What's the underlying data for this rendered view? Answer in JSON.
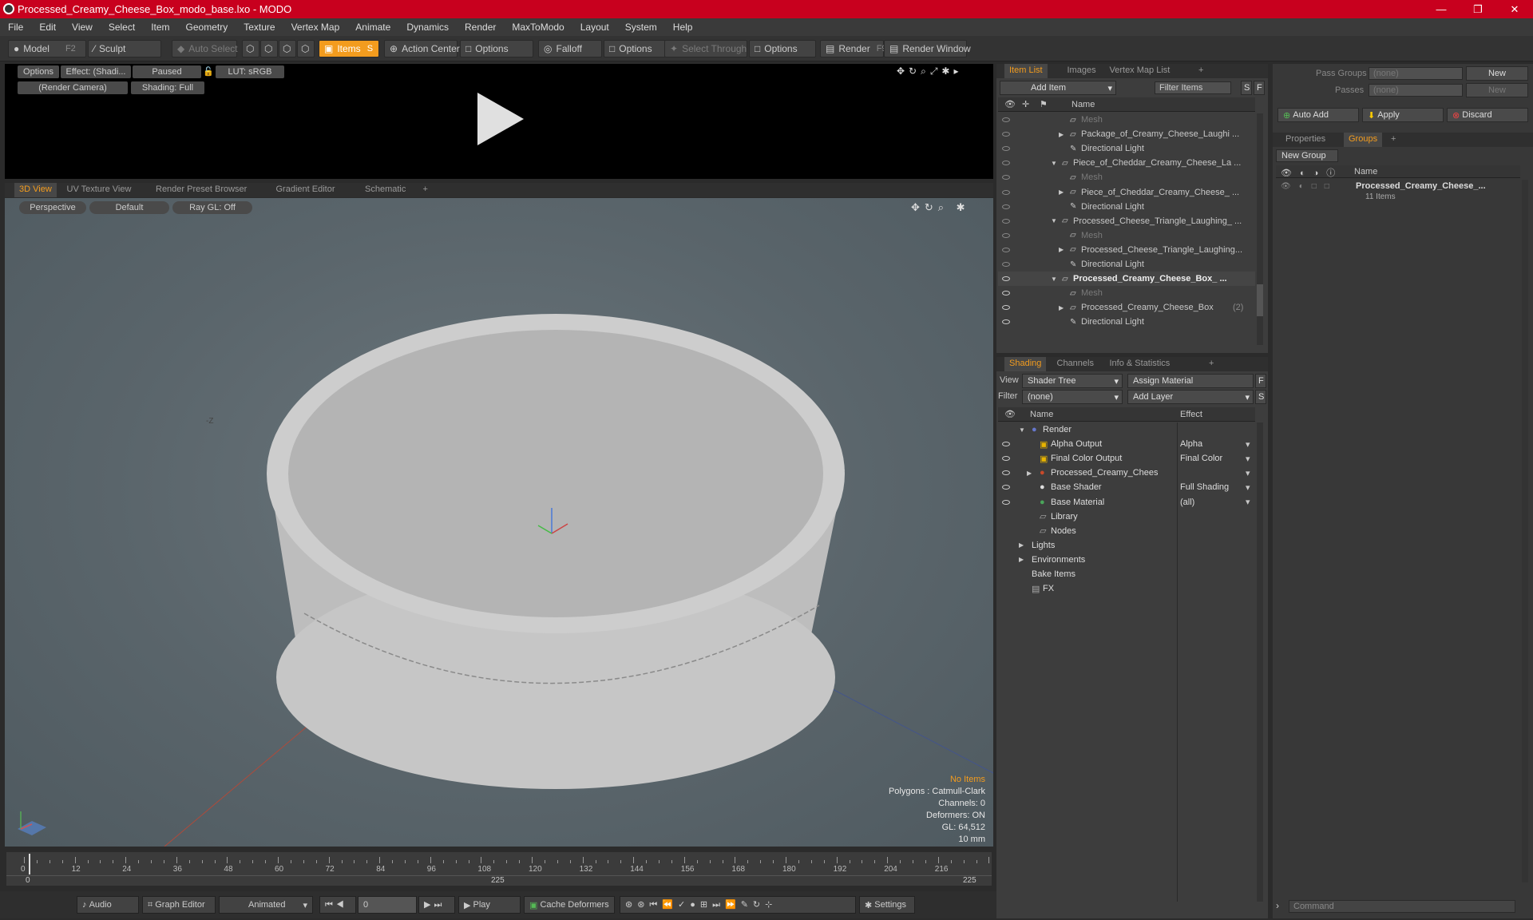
{
  "window": {
    "title": "Processed_Creamy_Cheese_Box_modo_base.lxo - MODO",
    "controls": [
      "—",
      "❐",
      "✕"
    ]
  },
  "menu": [
    "File",
    "Edit",
    "View",
    "Select",
    "Item",
    "Geometry",
    "Texture",
    "Vertex Map",
    "Animate",
    "Dynamics",
    "Render",
    "MaxToModo",
    "Layout",
    "System",
    "Help"
  ],
  "toolbar": {
    "model": "Model",
    "model_key": "F2",
    "sculpt": "Sculpt",
    "auto_select": "Auto Select",
    "items": "Items",
    "items_key": "S",
    "action_center": "Action Center",
    "options1": "Options",
    "falloff": "Falloff",
    "options2": "Options",
    "select_through": "Select Through",
    "options3": "Options",
    "render": "Render",
    "render_key": "F9",
    "render_window": "Render Window"
  },
  "render_preview": {
    "options": "Options",
    "effect": "Effect: (Shadi...",
    "paused": "Paused",
    "lut": "LUT: sRGB",
    "camera": "(Render Camera)",
    "shading": "Shading: Full"
  },
  "viewport_tabs": [
    "3D View",
    "UV Texture View",
    "Render Preset Browser",
    "Gradient Editor",
    "Schematic",
    "+"
  ],
  "viewport": {
    "perspective": "Perspective",
    "default": "Default",
    "raygl": "Ray GL: Off",
    "axis_label": "-Z",
    "stats": {
      "no_items": "No Items",
      "polygons": "Polygons : Catmull-Clark",
      "channels": "Channels: 0",
      "deformers": "Deformers: ON",
      "gl": "GL: 64,512",
      "size": "10 mm"
    }
  },
  "timeline": {
    "ticks": [
      "0",
      "12",
      "24",
      "36",
      "48",
      "60",
      "72",
      "84",
      "96",
      "108",
      "120",
      "132",
      "144",
      "156",
      "168",
      "180",
      "192",
      "204",
      "216"
    ],
    "start": "0",
    "mid": "225",
    "end": "225",
    "current": "0"
  },
  "bottom": {
    "audio": "Audio",
    "graph_editor": "Graph Editor",
    "animated": "Animated",
    "frame": "0",
    "play": "Play",
    "cache": "Cache Deformers",
    "settings": "Settings"
  },
  "item_list": {
    "tabs": [
      "Item List",
      "Images",
      "Vertex Map List",
      "+"
    ],
    "add_item": "Add Item",
    "filter": "Filter Items",
    "s": "S",
    "f": "F",
    "col_name": "Name",
    "rows": [
      {
        "label": "Mesh",
        "indent": 3,
        "dim": true,
        "arrow": ""
      },
      {
        "label": "Package_of_Creamy_Cheese_Laughi ...",
        "indent": 3,
        "dim": false,
        "arrow": "▶"
      },
      {
        "label": "Directional Light",
        "indent": 3,
        "dim": false,
        "arrow": ""
      },
      {
        "label": "Piece_of_Cheddar_Creamy_Cheese_La ...",
        "indent": 2,
        "dim": false,
        "arrow": "▼"
      },
      {
        "label": "Mesh",
        "indent": 3,
        "dim": true,
        "arrow": ""
      },
      {
        "label": "Piece_of_Cheddar_Creamy_Cheese_ ...",
        "indent": 3,
        "dim": false,
        "arrow": "▶"
      },
      {
        "label": "Directional Light",
        "indent": 3,
        "dim": false,
        "arrow": ""
      },
      {
        "label": "Processed_Cheese_Triangle_Laughing_ ...",
        "indent": 2,
        "dim": false,
        "arrow": "▼"
      },
      {
        "label": "Mesh",
        "indent": 3,
        "dim": true,
        "arrow": ""
      },
      {
        "label": "Processed_Cheese_Triangle_Laughing...",
        "indent": 3,
        "dim": false,
        "arrow": "▶"
      },
      {
        "label": "Directional Light",
        "indent": 3,
        "dim": false,
        "arrow": ""
      },
      {
        "label": "Processed_Creamy_Cheese_Box_ ...",
        "indent": 2,
        "dim": false,
        "arrow": "▼",
        "bold": true
      },
      {
        "label": "Mesh",
        "indent": 3,
        "dim": true,
        "arrow": ""
      },
      {
        "label": "Processed_Creamy_Cheese_Box",
        "indent": 3,
        "dim": false,
        "arrow": "▶",
        "suffix": "(2)"
      },
      {
        "label": "Directional Light",
        "indent": 3,
        "dim": false,
        "arrow": ""
      }
    ]
  },
  "shading": {
    "tabs": [
      "Shading",
      "Channels",
      "Info & Statistics",
      "+"
    ],
    "view_label": "View",
    "view_value": "Shader Tree",
    "assign": "Assign Material",
    "f": "F",
    "filter_label": "Filter",
    "filter_value": "(none)",
    "add_layer": "Add Layer",
    "s": "S",
    "col_name": "Name",
    "col_effect": "Effect",
    "rows": [
      {
        "label": "Render",
        "effect": "",
        "indent": 0,
        "arrow": "▼",
        "icon": "sphere"
      },
      {
        "label": "Alpha Output",
        "effect": "Alpha",
        "indent": 1,
        "arrow": "",
        "icon": "out"
      },
      {
        "label": "Final Color Output",
        "effect": "Final Color",
        "indent": 1,
        "arrow": "",
        "icon": "out"
      },
      {
        "label": "Processed_Creamy_Chees...",
        "effect": "",
        "indent": 1,
        "arrow": "▶",
        "icon": "mat"
      },
      {
        "label": "Base Shader",
        "effect": "Full Shading",
        "indent": 1,
        "arrow": "",
        "icon": "shader"
      },
      {
        "label": "Base Material",
        "effect": "(all)",
        "indent": 1,
        "arrow": "",
        "icon": "basemat"
      },
      {
        "label": "Library",
        "effect": "",
        "indent": 1,
        "arrow": "",
        "icon": "folder"
      },
      {
        "label": "Nodes",
        "effect": "",
        "indent": 1,
        "arrow": "",
        "icon": "folder"
      },
      {
        "label": "Lights",
        "effect": "",
        "indent": 0,
        "arrow": "▶",
        "icon": ""
      },
      {
        "label": "Environments",
        "effect": "",
        "indent": 0,
        "arrow": "▶",
        "icon": ""
      },
      {
        "label": "Bake Items",
        "effect": "",
        "indent": 0,
        "arrow": "",
        "icon": ""
      },
      {
        "label": "FX",
        "effect": "",
        "indent": 0,
        "arrow": "",
        "icon": "fx"
      }
    ]
  },
  "right_panel": {
    "pass_groups": "Pass Groups",
    "pass_value": "(none)",
    "new": "New",
    "passes": "Passes",
    "passes_value": "(none)",
    "new2": "New",
    "auto_add": "Auto Add",
    "apply": "Apply",
    "discard": "Discard",
    "tabs": [
      "Properties",
      "Groups",
      "+"
    ],
    "new_group": "New Group",
    "col_name": "Name",
    "group_name": "Processed_Creamy_Cheese_...",
    "group_count": "11 Items",
    "command": "Command"
  },
  "colors": {
    "title_red": "#c8001e",
    "accent_orange": "#f39c1e",
    "viewport_bg": "#5f6a70"
  }
}
